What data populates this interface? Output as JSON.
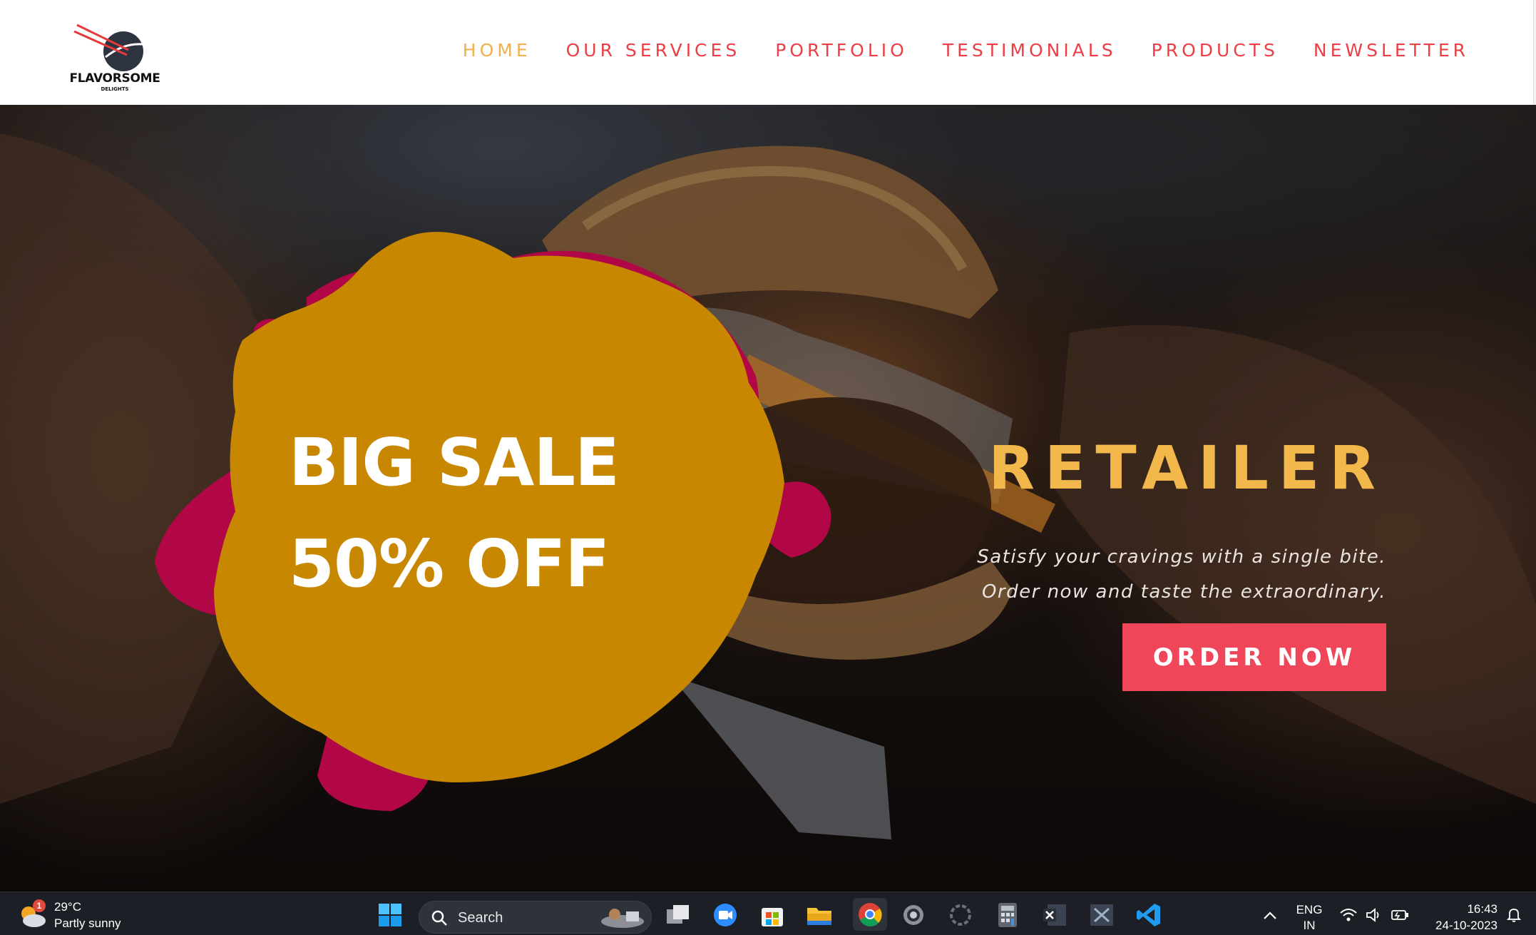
{
  "brand": {
    "name": "FLAVORSOME",
    "tagline": "DELIGHTS"
  },
  "nav": {
    "items": [
      {
        "label": "HOME",
        "active": true
      },
      {
        "label": "OUR SERVICES",
        "active": false
      },
      {
        "label": "PORTFOLIO",
        "active": false
      },
      {
        "label": "TESTIMONIALS",
        "active": false
      },
      {
        "label": "PRODUCTS",
        "active": false
      },
      {
        "label": "NEWSLETTER",
        "active": false
      }
    ]
  },
  "hero": {
    "sale_line1": "BIG SALE",
    "sale_line2": "50% OFF",
    "title": "RETAILER",
    "tagline": "Satisfy your cravings with a single bite. Order now and taste the extraordinary.",
    "cta_label": "ORDER NOW"
  },
  "colors": {
    "nav_link": "#ec3f45",
    "nav_active": "#f2b04f",
    "title": "#f2b84b",
    "cta": "#f0465a",
    "blob_yellow": "#ffae00",
    "blob_pink": "#e5095b"
  },
  "taskbar": {
    "weather": {
      "temp": "29°C",
      "desc": "Partly sunny",
      "badge": "1"
    },
    "search_placeholder": "Search",
    "icons": [
      "windows-start-icon",
      "task-view-icon",
      "zoom-meeting-icon",
      "microsoft-store-icon",
      "file-explorer-icon",
      "chrome-icon",
      "settings-icon",
      "loading-app-icon",
      "calculator-icon",
      "excel-icon",
      "snipping-tool-icon",
      "vscode-icon"
    ],
    "tray": {
      "lang_line1": "ENG",
      "lang_line2": "IN",
      "time": "16:43",
      "date": "24-10-2023"
    }
  }
}
